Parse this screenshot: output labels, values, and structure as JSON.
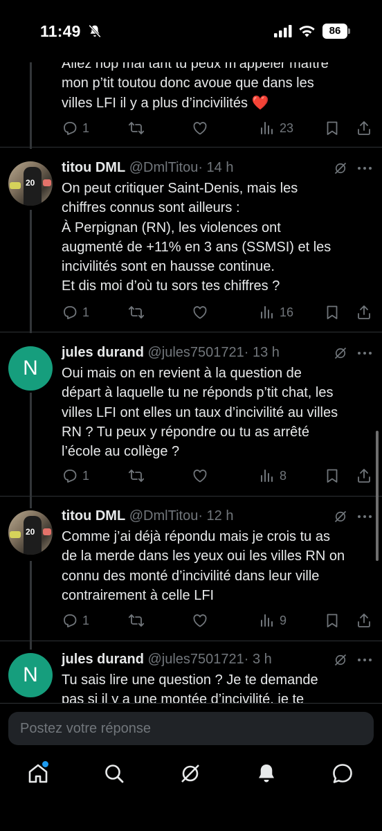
{
  "status_bar": {
    "time": "11:49",
    "battery": "86",
    "icons": [
      "bell-slash-icon",
      "cellular-signal-icon",
      "wifi-icon",
      "battery-icon"
    ]
  },
  "tweets": [
    {
      "lines": [
        "Allez hop mai tant tu peux m’appeler maître",
        "mon p’tit toutou donc avoue que dans les",
        "villes LFI il y a plus d’incivilités ❤️"
      ],
      "replies": "1",
      "retweets": "",
      "likes": "",
      "views": "23"
    },
    {
      "name": "titou DML",
      "handle": "@DmlTitou",
      "time": "· 14 h",
      "lines": [
        "On peut critiquer Saint-Denis, mais les",
        "chiffres connus sont ailleurs :",
        "À Perpignan (RN), les violences ont",
        "augmenté de +11% en 3 ans (SSMSI) et les",
        "incivilités sont en hausse continue.",
        "Et dis moi d’où tu sors tes chiffres ?"
      ],
      "replies": "1",
      "retweets": "",
      "likes": "",
      "views": "16"
    },
    {
      "name": "jules durand",
      "handle": "@jules7501721",
      "time": "· 13 h",
      "avatar_letter": "N",
      "lines": [
        "Oui mais on en revient à la question de",
        "départ à laquelle tu ne réponds p’tit chat, les",
        "villes LFI ont elles un taux d’incivilité au villes",
        "RN ?  Tu peux y répondre ou tu as arrêté",
        "l’école au collège ?"
      ],
      "replies": "1",
      "retweets": "",
      "likes": "",
      "views": "8"
    },
    {
      "name": "titou DML",
      "handle": "@DmlTitou",
      "time": "· 12 h",
      "lines": [
        "Comme j’ai déjà répondu mais je crois tu as",
        "de la merde dans les yeux oui les villes RN on",
        "connu des monté d’incivilité dans leur ville",
        "contrairement à celle LFI"
      ],
      "replies": "1",
      "retweets": "",
      "likes": "",
      "views": "9"
    },
    {
      "name": "jules durand",
      "handle": "@jules7501721",
      "time": "· 3 h",
      "avatar_letter": "N",
      "lines": [
        "Tu sais lire une question ? Je te demande",
        "pas si il y a une montée d’incivilité, je te"
      ]
    }
  ],
  "reply_box": {
    "placeholder": "Postez votre réponse"
  },
  "tabbar": {
    "items": [
      "home-icon",
      "search-icon",
      "grok-icon",
      "notifications-icon",
      "messages-icon"
    ]
  },
  "colors": {
    "background": "#000000",
    "text": "#e7e9ea",
    "muted": "#71767b",
    "accent": "#1d9bf0",
    "avatar_green": "#169e7d"
  }
}
